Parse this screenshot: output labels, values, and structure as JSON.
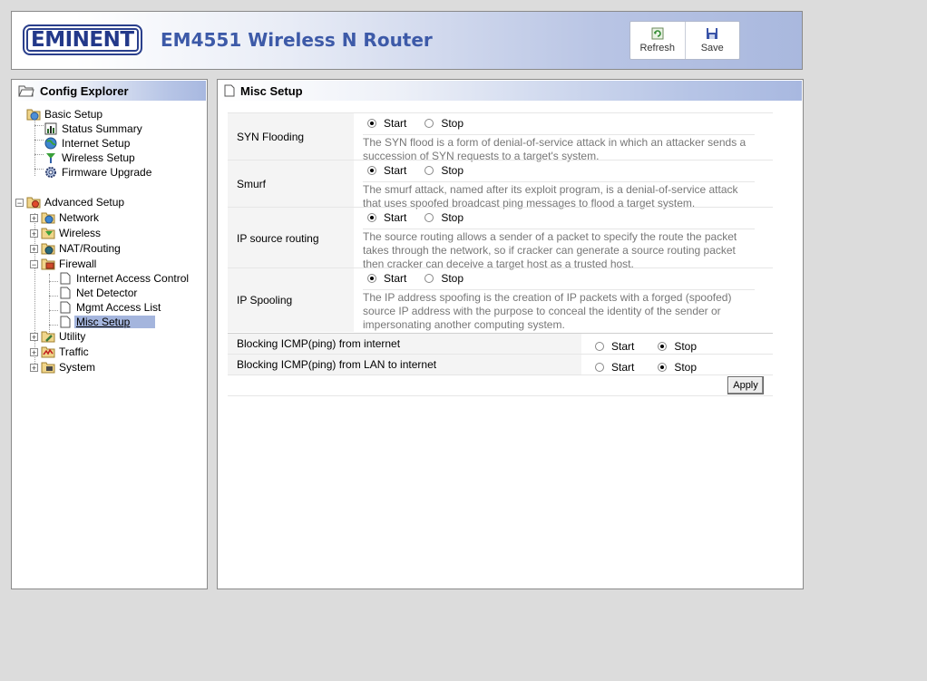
{
  "header": {
    "brand": "EMINENT",
    "product_title": "EM4551 Wireless N Router",
    "refresh_label": "Refresh",
    "save_label": "Save"
  },
  "explorer": {
    "title": "Config Explorer",
    "basic": {
      "label": "Basic Setup",
      "items": [
        "Status Summary",
        "Internet Setup",
        "Wireless Setup",
        "Firmware Upgrade"
      ]
    },
    "advanced": {
      "label": "Advanced Setup",
      "network": "Network",
      "wireless": "Wireless",
      "nat": "NAT/Routing",
      "firewall": "Firewall",
      "firewall_items": [
        "Internet Access Control",
        "Net Detector",
        "Mgmt Access List",
        "Misc Setup"
      ],
      "utility": "Utility",
      "traffic": "Traffic",
      "system": "System"
    }
  },
  "main": {
    "title": "Misc Setup",
    "start_label": "Start",
    "stop_label": "Stop",
    "apply_label": "Apply",
    "settings": [
      {
        "label": "SYN Flooding",
        "value": "Start",
        "desc": "The SYN flood is a form of denial-of-service attack in which an attacker sends a succession of SYN requests to a target's system."
      },
      {
        "label": "Smurf",
        "value": "Start",
        "desc": "The smurf attack, named after its exploit program, is a denial-of-service attack that uses spoofed broadcast ping messages to flood a target system."
      },
      {
        "label": "IP source routing",
        "value": "Start",
        "desc": "The source routing allows a sender of a packet to specify the route the packet takes through the network, so if cracker can generate a source routing packet then cracker can deceive a target host as a trusted host."
      },
      {
        "label": "IP Spooling",
        "value": "Start",
        "desc": "The IP address spoofing is the creation of IP packets with a forged (spoofed) source IP address with the purpose to conceal the identity of the sender or impersonating another computing system."
      }
    ],
    "icmp": [
      {
        "label": "Blocking ICMP(ping) from internet",
        "value": "Stop"
      },
      {
        "label": "Blocking ICMP(ping) from LAN to internet",
        "value": "Stop"
      }
    ]
  },
  "colors": {
    "accent": "#a4b5dd",
    "brand": "#23398a"
  }
}
